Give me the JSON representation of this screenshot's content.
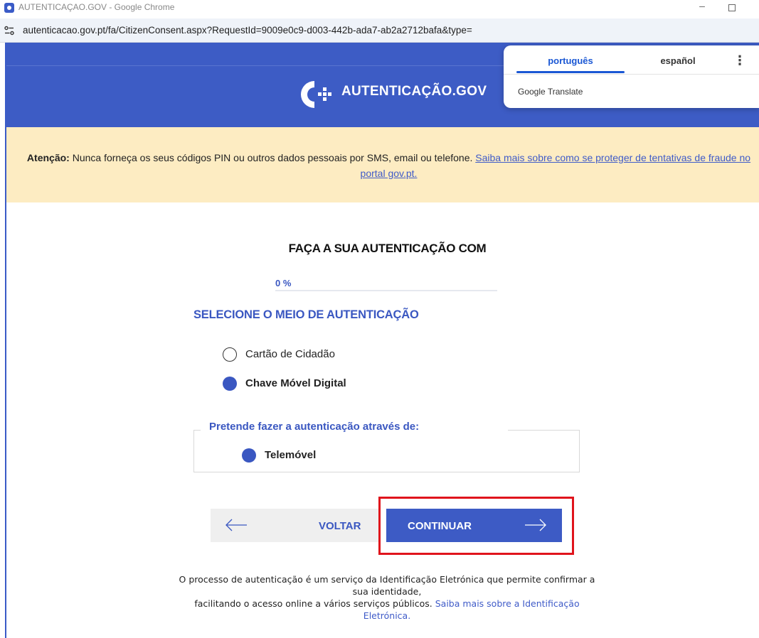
{
  "browser": {
    "window_title": "AUTENTICAÇAO.GOV - Google Chrome",
    "url": "autenticacao.gov.pt/fa/CitizenConsent.aspx?RequestId=9009e0c9-d003-442b-ada7-ab2a2712bafa&type="
  },
  "header": {
    "logo_text": "AUTENTICAÇÃO.GOV"
  },
  "translate_popup": {
    "tabs": [
      "português",
      "español"
    ],
    "selected_tab": "português",
    "brand": "Google Translate"
  },
  "warning": {
    "prefix": "Atenção:",
    "message": " Nunca forneça os seus códigos PIN ou outros dados pessoais por SMS, email ou telefone. ",
    "link_text": "Saiba mais sobre como se proteger de tentativas de fraude no portal gov.pt."
  },
  "main": {
    "title": "FAÇA A SUA AUTENTICAÇÃO COM",
    "progress_label": "0 %",
    "progress_value": 0,
    "section_heading": "SELECIONE O MEIO DE AUTENTICAÇÃO",
    "options": [
      {
        "label": "Cartão de Cidadão",
        "selected": false
      },
      {
        "label": "Chave Móvel Digital",
        "selected": true
      }
    ],
    "method_legend": "Pretende fazer a autenticação através de:",
    "method_option": {
      "label": "Telemóvel",
      "selected": true
    }
  },
  "buttons": {
    "back_label": "VOLTAR",
    "continue_label": "CONTINUAR"
  },
  "footer": {
    "line1": "O processo de autenticação é um serviço da Identificação Eletrónica que permite confirmar a sua identidade,",
    "line2": "facilitando o acesso online a vários serviços públicos. ",
    "link_text": "Saiba mais sobre a Identificação Eletrónica."
  },
  "colors": {
    "brand_blue": "#3d5cc5",
    "warning_bg": "#fdecc2",
    "highlight_red": "#e0141c",
    "translate_blue": "#1a57d4"
  }
}
